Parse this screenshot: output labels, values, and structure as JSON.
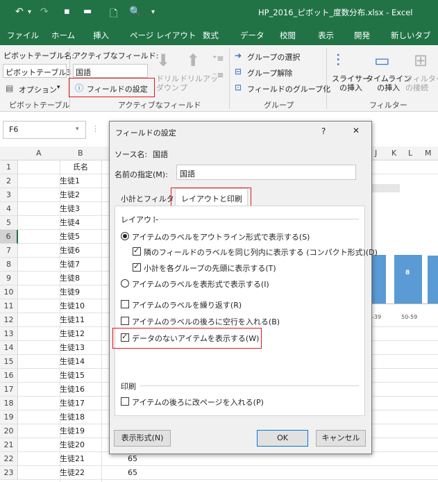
{
  "window": {
    "title": "HP_2016_ピボット_度数分布.xlsx - Excel",
    "qat": {
      "undo": "↶",
      "redo": "↷",
      "save": "💾",
      "open": "📂",
      "new": "🗋",
      "print_preview": "🔍",
      "more": "▾"
    }
  },
  "menu": [
    "ファイル",
    "ホーム",
    "挿入",
    "ページ レイアウト",
    "数式",
    "データ",
    "校閲",
    "表示",
    "開発",
    "新しいタブ"
  ],
  "ribbon": {
    "pivot_table_name_label": "ピボットテーブル名:",
    "pivot_table_name_value": "ピボットテーブル3",
    "options_label": "オプション",
    "group_pivot": "ピボットテーブル",
    "active_field_label": "アクティブなフィールド:",
    "active_field_value": "国語",
    "field_settings_label": "フィールドの設定",
    "drill_down": "ドリル\nダウン",
    "drill_up": "ドリルアッ\nプ",
    "group_active": "アクティブなフィールド",
    "group_selection": "グループの選択",
    "ungroup": "グループ解除",
    "group_field": "フィールドのグループ化",
    "group_group": "グループ",
    "insert_slicer": "スライサー\nの挿入",
    "insert_timeline": "タイムライン\nの挿入",
    "filter_connections": "フィルター\nの接続",
    "group_filter": "フィルター"
  },
  "namebox": "F6",
  "columns": [
    "A",
    "B",
    "C",
    "J",
    "K",
    "L",
    "M"
  ],
  "rows": [
    {
      "num": "1",
      "b": "氏名",
      "c": ""
    },
    {
      "num": "2",
      "b": "生徒1",
      "c": ""
    },
    {
      "num": "3",
      "b": "生徒2",
      "c": ""
    },
    {
      "num": "4",
      "b": "生徒3",
      "c": ""
    },
    {
      "num": "5",
      "b": "生徒4",
      "c": ""
    },
    {
      "num": "6",
      "b": "生徒5",
      "c": ""
    },
    {
      "num": "7",
      "b": "生徒6",
      "c": ""
    },
    {
      "num": "8",
      "b": "生徒7",
      "c": ""
    },
    {
      "num": "9",
      "b": "生徒8",
      "c": ""
    },
    {
      "num": "10",
      "b": "生徒9",
      "c": ""
    },
    {
      "num": "11",
      "b": "生徒10",
      "c": ""
    },
    {
      "num": "12",
      "b": "生徒11",
      "c": ""
    },
    {
      "num": "13",
      "b": "生徒12",
      "c": ""
    },
    {
      "num": "14",
      "b": "生徒13",
      "c": ""
    },
    {
      "num": "15",
      "b": "生徒14",
      "c": ""
    },
    {
      "num": "16",
      "b": "生徒15",
      "c": ""
    },
    {
      "num": "17",
      "b": "生徒16",
      "c": ""
    },
    {
      "num": "18",
      "b": "生徒17",
      "c": ""
    },
    {
      "num": "19",
      "b": "生徒18",
      "c": ""
    },
    {
      "num": "20",
      "b": "生徒19",
      "c": ""
    },
    {
      "num": "21",
      "b": "生徒20",
      "c": ""
    },
    {
      "num": "22",
      "b": "生徒21",
      "c": "65"
    },
    {
      "num": "23",
      "b": "生徒22",
      "c": "65"
    }
  ],
  "chart": {
    "bar_label": "8",
    "axis_labels": [
      "-39",
      "50-59"
    ]
  },
  "dialog": {
    "title": "フィールドの設定",
    "help": "?",
    "close": "✕",
    "source_label": "ソース名:",
    "source_value": "国語",
    "name_label": "名前の指定(M):",
    "name_value": "国語",
    "tabs": [
      "小計とフィルター",
      "レイアウトと印刷"
    ],
    "layout_header": "レイアウト",
    "opt_outline": "アイテムのラベルをアウトライン形式で表示する(S)",
    "opt_compact": "隣のフィールドのラベルを同じ列内に表示する (コンパクト形式)(D)",
    "opt_subtotal_top": "小計を各グループの先頭に表示する(T)",
    "opt_tabular": "アイテムのラベルを表形式で表示する(I)",
    "opt_repeat": "アイテムのラベルを繰り返す(R)",
    "opt_blank_line": "アイテムのラベルの後ろに空行を入れる(B)",
    "opt_show_empty": "データのないアイテムを表示する(W)",
    "print_header": "印刷",
    "opt_page_break": "アイテムの後ろに改ページを入れる(P)",
    "number_format": "表示形式(N)",
    "ok": "OK",
    "cancel": "キャンセル"
  }
}
